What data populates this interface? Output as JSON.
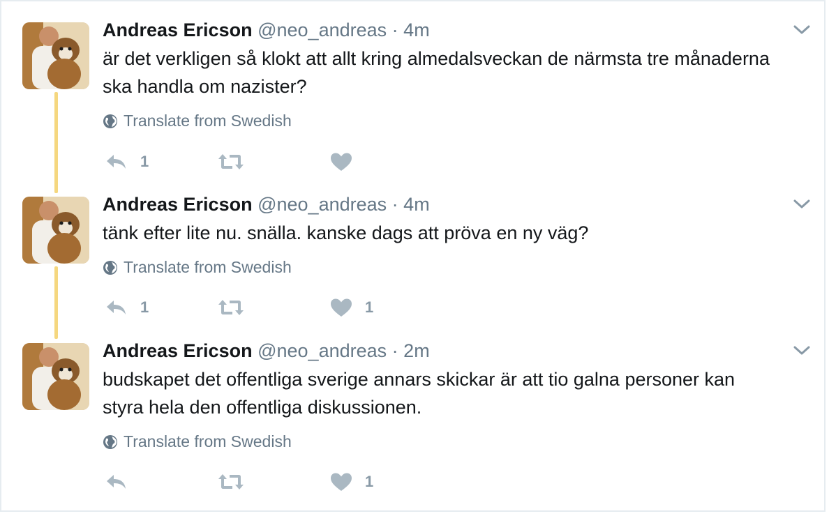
{
  "tweets": [
    {
      "name": "Andreas Ericson",
      "handle": "@neo_andreas",
      "separator": "·",
      "time": "4m",
      "text": "är det verkligen så klokt att allt kring almedalsveckan de närmsta tre månaderna ska handla om nazister?",
      "translate": "Translate from Swedish",
      "reply_count": "1",
      "retweet_count": "",
      "like_count": ""
    },
    {
      "name": "Andreas Ericson",
      "handle": "@neo_andreas",
      "separator": "·",
      "time": "4m",
      "text": "tänk efter lite nu. snälla. kanske dags att pröva en ny väg?",
      "translate": "Translate from Swedish",
      "reply_count": "1",
      "retweet_count": "",
      "like_count": "1"
    },
    {
      "name": "Andreas Ericson",
      "handle": "@neo_andreas",
      "separator": "·",
      "time": "2m",
      "text": "budskapet det offentliga sverige annars skickar är att tio galna personer kan styra hela den offentliga diskussionen.",
      "translate": "Translate from Swedish",
      "reply_count": "",
      "retweet_count": "",
      "like_count": "1"
    }
  ],
  "icons": {
    "caret": "chevron-down-icon",
    "globe": "globe-icon",
    "reply": "reply-icon",
    "retweet": "retweet-icon",
    "like": "heart-icon"
  },
  "colors": {
    "text": "#14171a",
    "secondary": "#657786",
    "action": "#aab8c2",
    "thread_line": "#f5d77f"
  }
}
